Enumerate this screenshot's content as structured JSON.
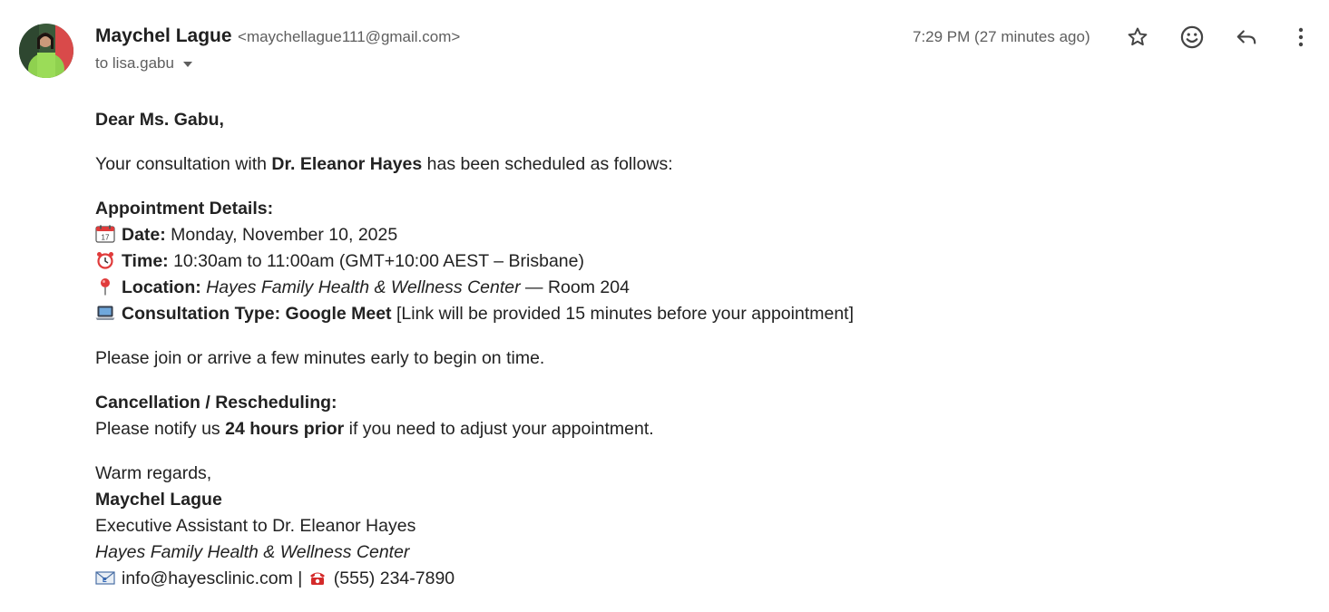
{
  "header": {
    "sender_name": "Maychel Lague",
    "sender_email": "<maychellague111@gmail.com>",
    "recipient": "to lisa.gabu",
    "time": "7:29 PM (27 minutes ago)",
    "icons": [
      "star-icon",
      "emoji-icon",
      "reply-icon",
      "more-vert-icon"
    ]
  },
  "email": {
    "greeting": "Dear Ms. Gabu,",
    "intro": {
      "before": "Your consultation with ",
      "doctor": "Dr. Eleanor Hayes",
      "after": " has been scheduled as follows:"
    },
    "details": {
      "heading": "Appointment Details:",
      "date_label": "Date:",
      "date_value": " Monday, November 10, 2025",
      "time_label": "Time:",
      "time_value": " 10:30am to 11:00am  (GMT+10:00 AEST – Brisbane)",
      "location_label": "Location:",
      "location_value": "Hayes Family Health & Wellness Center",
      "location_room": " — Room 204",
      "type_label": "Consultation Type: Google Meet",
      "type_value": " [Link will be provided 15 minutes before your appointment]"
    },
    "arrive_note": "Please join or arrive a few minutes early to begin on time.",
    "cancellation": {
      "heading": "Cancellation / Rescheduling:",
      "before": "Please notify us ",
      "bold": "24 hours prior",
      "after": " if you need to adjust your appointment."
    },
    "signature": {
      "closing": "Warm regards,",
      "name": "Maychel Lague",
      "title": "Executive Assistant to Dr. Eleanor Hayes",
      "org": "Hayes Family Health & Wellness Center",
      "email": "info@hayesclinic.com",
      "separator": " | ",
      "phone": "(555) 234-7890"
    }
  },
  "colors": {
    "muted_text": "#5e5e5e",
    "body_text": "#222222",
    "avatar_jacket": "#8fd14f",
    "avatar_bg": "#d94a4a"
  }
}
